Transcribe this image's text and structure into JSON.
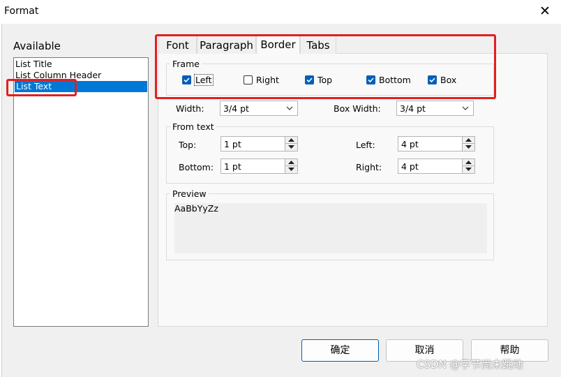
{
  "window": {
    "title": "Format",
    "close_glyph": "✕"
  },
  "available": {
    "label": "Available",
    "items": [
      "List Title",
      "List Column Header",
      "List Text"
    ],
    "selected": "List Text"
  },
  "tabs": [
    {
      "label": "Font"
    },
    {
      "label": "Paragraph"
    },
    {
      "label": "Border",
      "active": true
    },
    {
      "label": "Tabs"
    }
  ],
  "frame": {
    "label": "Frame",
    "options": [
      {
        "label": "Left",
        "checked": true
      },
      {
        "label": "Right",
        "checked": false
      },
      {
        "label": "Top",
        "checked": true
      },
      {
        "label": "Bottom",
        "checked": true
      },
      {
        "label": "Box",
        "checked": true
      }
    ]
  },
  "width": {
    "label": "Width:",
    "value": "3/4 pt"
  },
  "box_width": {
    "label": "Box Width:",
    "value": "3/4 pt"
  },
  "from_text": {
    "label": "From text",
    "top": {
      "label": "Top:",
      "value": "1 pt"
    },
    "bottom": {
      "label": "Bottom:",
      "value": "1 pt"
    },
    "left": {
      "label": "Left:",
      "value": "4 pt"
    },
    "right": {
      "label": "Right:",
      "value": "4 pt"
    }
  },
  "preview": {
    "label": "Preview",
    "sample": "AaBbYyZz"
  },
  "buttons": {
    "ok": "确定",
    "cancel": "取消",
    "help": "帮助"
  },
  "watermark": "CSDN @字节尚未跳动",
  "colors": {
    "highlight": "#e02020",
    "selection": "#0078d7",
    "checkbox": "#005fb8"
  }
}
